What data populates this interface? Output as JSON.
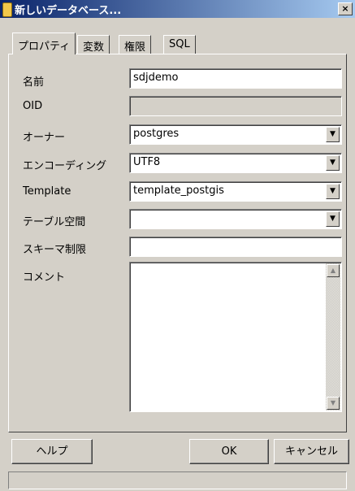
{
  "window": {
    "title": "新しいデータベース...",
    "close_label": "×"
  },
  "tabs": [
    {
      "label": "プロパティ"
    },
    {
      "label": "変数"
    },
    {
      "label": "権限"
    },
    {
      "label": "SQL"
    }
  ],
  "form": {
    "name_label": "名前",
    "name_value": "sdjdemo",
    "oid_label": "OID",
    "oid_value": "",
    "owner_label": "オーナー",
    "owner_value": "postgres",
    "encoding_label": "エンコーディング",
    "encoding_value": "UTF8",
    "template_label": "Template",
    "template_value": "template_postgis",
    "tablespace_label": "テーブル空間",
    "tablespace_value": "",
    "schema_restriction_label": "スキーマ制限",
    "schema_restriction_value": "",
    "comment_label": "コメント",
    "comment_value": ""
  },
  "buttons": {
    "help": "ヘルプ",
    "ok": "OK",
    "cancel": "キャンセル"
  },
  "icons": {
    "arrow_down": "▼",
    "arrow_up": "▲"
  }
}
